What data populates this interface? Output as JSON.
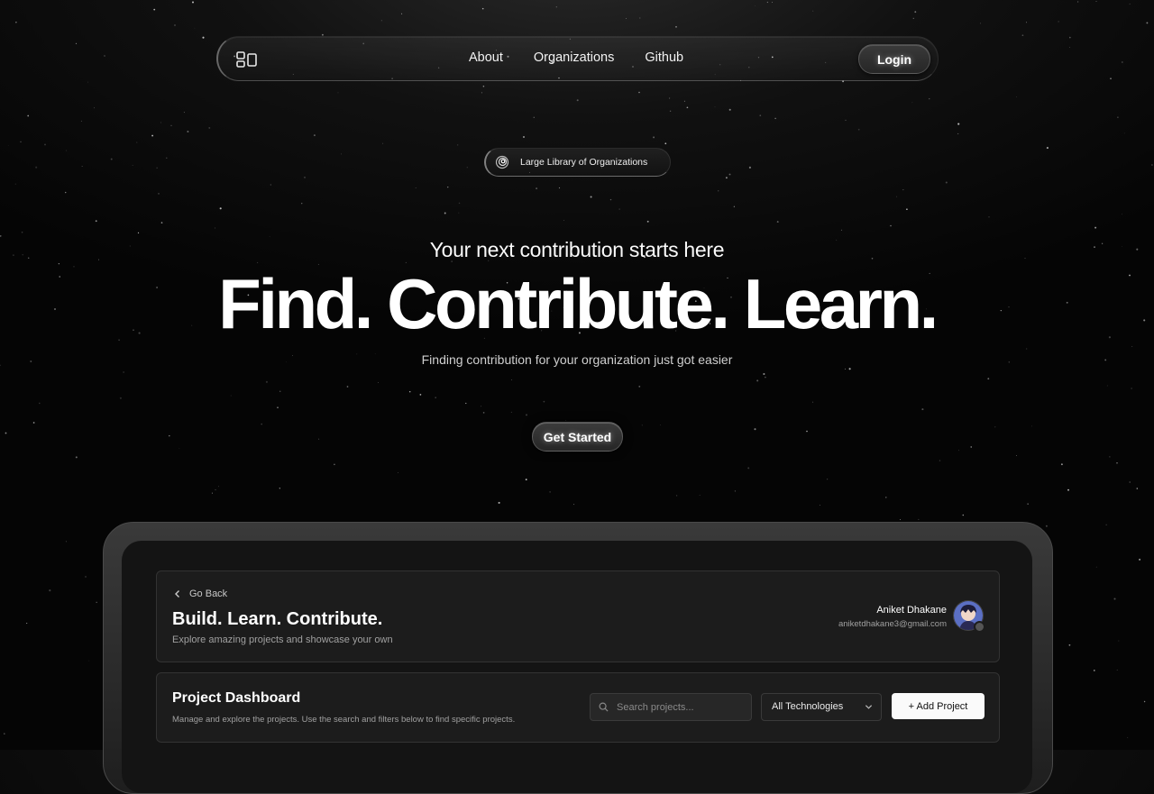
{
  "nav": {
    "logo_icon": "layout-grid-icon",
    "links": [
      "About",
      "Organizations",
      "Github"
    ],
    "login_label": "Login"
  },
  "badge": {
    "icon": "spiral-icon",
    "label": "Large Library of Organizations"
  },
  "hero": {
    "subtitle": "Your next contribution starts here",
    "title": "Find. Contribute. Learn.",
    "description": "Finding contribution for your organization just got easier",
    "cta_label": "Get Started"
  },
  "dashboard": {
    "header": {
      "back_label": "Go Back",
      "back_icon": "chevron-left-icon",
      "title": "Build. Learn. Contribute.",
      "subtitle": "Explore amazing projects and showcase your own",
      "user_name": "Aniket Dhakane",
      "user_email": "aniketdhakane3@gmail.com"
    },
    "toolbar": {
      "title": "Project Dashboard",
      "description": "Manage and explore the projects. Use the search and filters below to find specific projects.",
      "search_placeholder": "Search projects...",
      "filter_value": "All Technologies",
      "add_label": "+ Add Project"
    }
  }
}
